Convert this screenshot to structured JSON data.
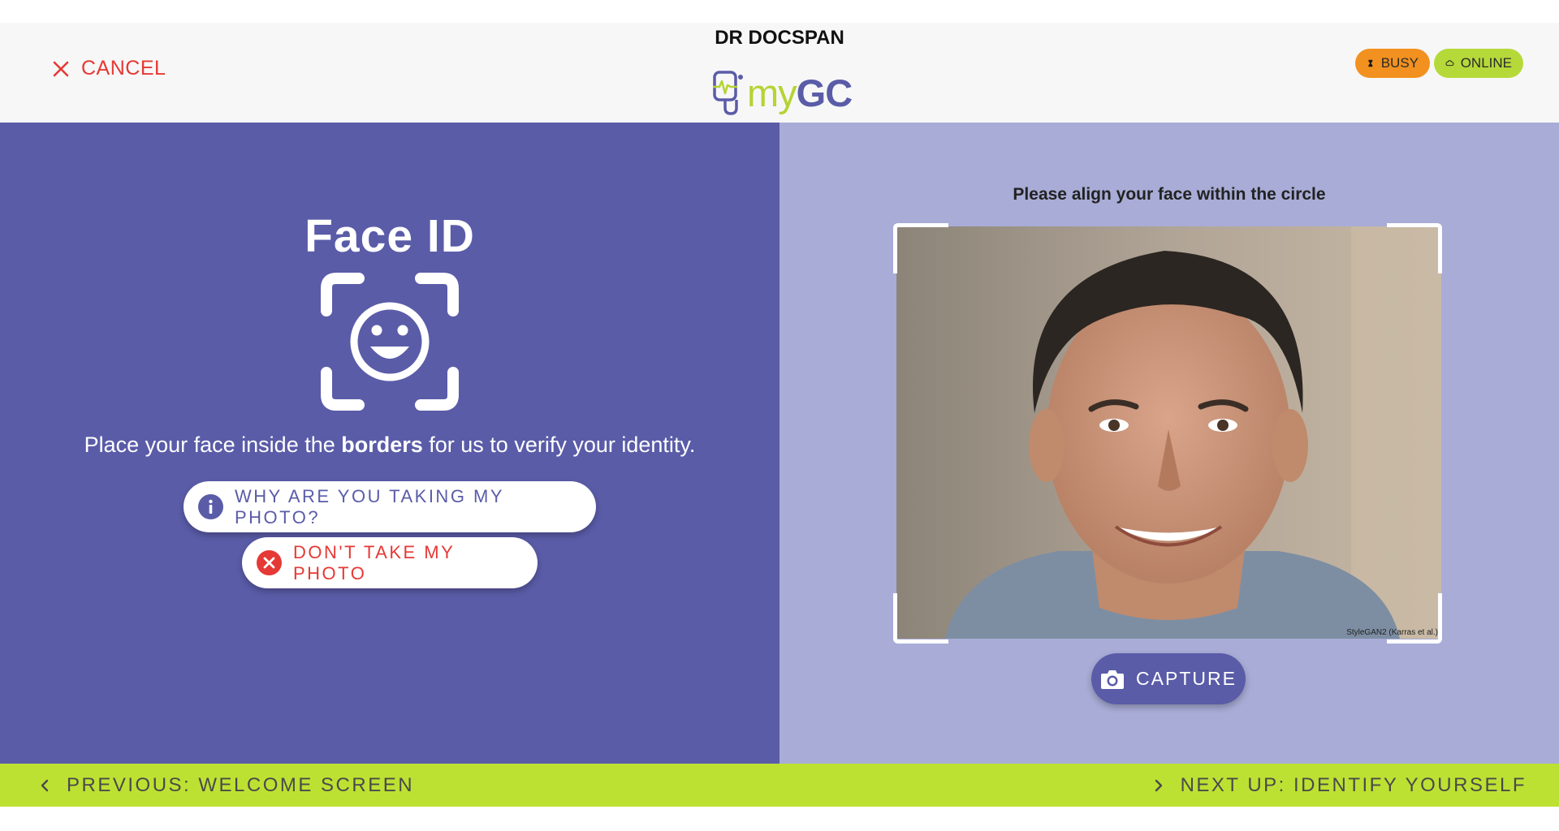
{
  "header": {
    "cancel_label": "CANCEL",
    "doctor_name": "DR DOCSPAN",
    "logo": {
      "my": "my",
      "gc": "GC"
    },
    "status": {
      "busy_label": "BUSY",
      "online_label": "ONLINE"
    }
  },
  "left_panel": {
    "title": "Face ID",
    "instruction_pre": "Place your face inside the ",
    "instruction_bold": "borders",
    "instruction_post": " for us to verify your identity.",
    "why_button": "WHY ARE YOU TAKING MY PHOTO?",
    "dont_button": "DON'T TAKE MY PHOTO"
  },
  "right_panel": {
    "align_text": "Please align your face within the circle",
    "photo_credit": "StyleGAN2 (Karras et al.)",
    "capture_label": "CAPTURE"
  },
  "footer": {
    "previous_label": "PREVIOUS: WELCOME SCREEN",
    "next_label": "NEXT UP: IDENTIFY YOURSELF"
  },
  "colors": {
    "primary": "#5a5ca8",
    "accent_green": "#bde133",
    "danger": "#e53935",
    "busy": "#f2911f",
    "panel_light": "#a8acd6"
  },
  "icons": [
    "close-icon",
    "hourglass-icon",
    "cloud-icon",
    "face-scan-icon",
    "info-icon",
    "cancel-circle-icon",
    "camera-icon",
    "chevron-left-icon",
    "chevron-right-icon"
  ]
}
